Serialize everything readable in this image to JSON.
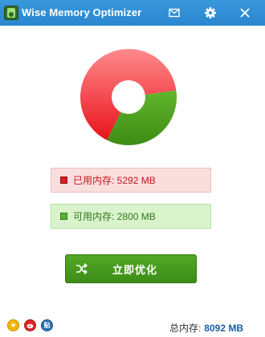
{
  "app": {
    "title": "Wise Memory Optimizer"
  },
  "titlebar": {
    "icons": [
      "mail-icon",
      "gear-icon",
      "close-icon"
    ]
  },
  "memory": {
    "used_label": "已用内存: 5292 MB",
    "free_label": "可用内存: 2800 MB",
    "used_mb": 5292,
    "free_mb": 2800,
    "total_label": "总内存:",
    "total_value": "8092 MB"
  },
  "chart_data": {
    "type": "pie",
    "categories": [
      "已用内存",
      "可用内存"
    ],
    "values": [
      5292,
      2800
    ],
    "colors": [
      "#f04a50",
      "#4f9e22"
    ]
  },
  "actions": {
    "optimize_label": "立即优化"
  },
  "social": {
    "icons": [
      "star-icon",
      "weibo-icon",
      "tieba-icon"
    ],
    "tieba_glyph": "贴"
  },
  "colors": {
    "titlebar": "#2f8ed5",
    "used": "#d51f25",
    "free": "#5cb132",
    "button": "#46991d",
    "total_value": "#1d5ea8"
  }
}
